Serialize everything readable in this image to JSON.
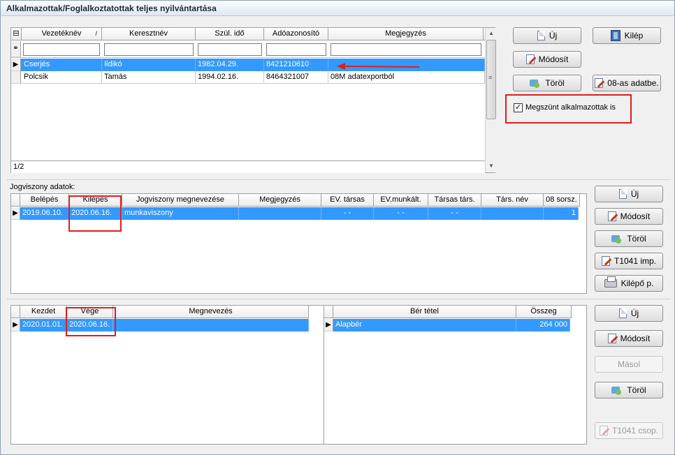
{
  "window": {
    "title": "Alkalmazottak/Foglalkoztatottak teljes nyilvántartása"
  },
  "employees": {
    "headers": [
      "Vezetéknév",
      "Keresztnév",
      "Szül. idő",
      "Adóazonosító",
      "Megjegyzés"
    ],
    "sort_mark": "/",
    "rows": [
      [
        "Cserjés",
        "Ildikó",
        "1982.04.29.",
        "8421210610",
        ""
      ],
      [
        "Polcsik",
        "Tamás",
        "1994.02.16.",
        "8464321007",
        "08M adatexportból"
      ]
    ],
    "record_counter": "1/2"
  },
  "top_buttons": {
    "new": "Új",
    "exit": "Kilép",
    "modify": "Módosít",
    "delete": "Töröl",
    "import08": "08-as adatbe."
  },
  "checkbox": {
    "label": "Megszünt alkalmazottak is",
    "checked": true,
    "mark": "✓"
  },
  "employment": {
    "section_label": "Jogviszony adatok:",
    "headers": [
      "Belépés",
      "Kilépés",
      "Jogviszony megnevezése",
      "Megjegyzés",
      "EV. társas",
      "EV.munkált.",
      "Társas társ.",
      "Társ. név",
      "08 sorsz."
    ],
    "rows": [
      [
        "2019.06.10.",
        "2020.06.16.",
        "munkaviszony",
        "",
        "- -",
        "- -",
        "- -",
        "",
        "1"
      ]
    ]
  },
  "employment_buttons": {
    "new": "Új",
    "modify": "Módosít",
    "delete": "Töröl",
    "t1041": "T1041 imp.",
    "exit_paper": "Kilépő p."
  },
  "periods": {
    "headers": [
      "Kezdet",
      "Vége",
      "Megnevezés"
    ],
    "rows": [
      [
        "2020.01.01.",
        "2020.06.16.",
        ""
      ]
    ]
  },
  "wages": {
    "headers": [
      "Bér tétel",
      "Összeg"
    ],
    "rows": [
      [
        "Alapbér",
        "264 000"
      ]
    ]
  },
  "bottom_buttons": {
    "new": "Új",
    "modify": "Módosít",
    "copy": "Másol",
    "delete": "Töröl",
    "t1041_group": "T1041 csop."
  },
  "colors": {
    "selection": "#3399ff",
    "annotation": "#e21b1b"
  },
  "icons": {
    "indicator": "▶",
    "binoculars": "⚭",
    "columns": "⊟",
    "scroll_up": "▲",
    "scroll_down": "▼",
    "grip": "≡"
  }
}
